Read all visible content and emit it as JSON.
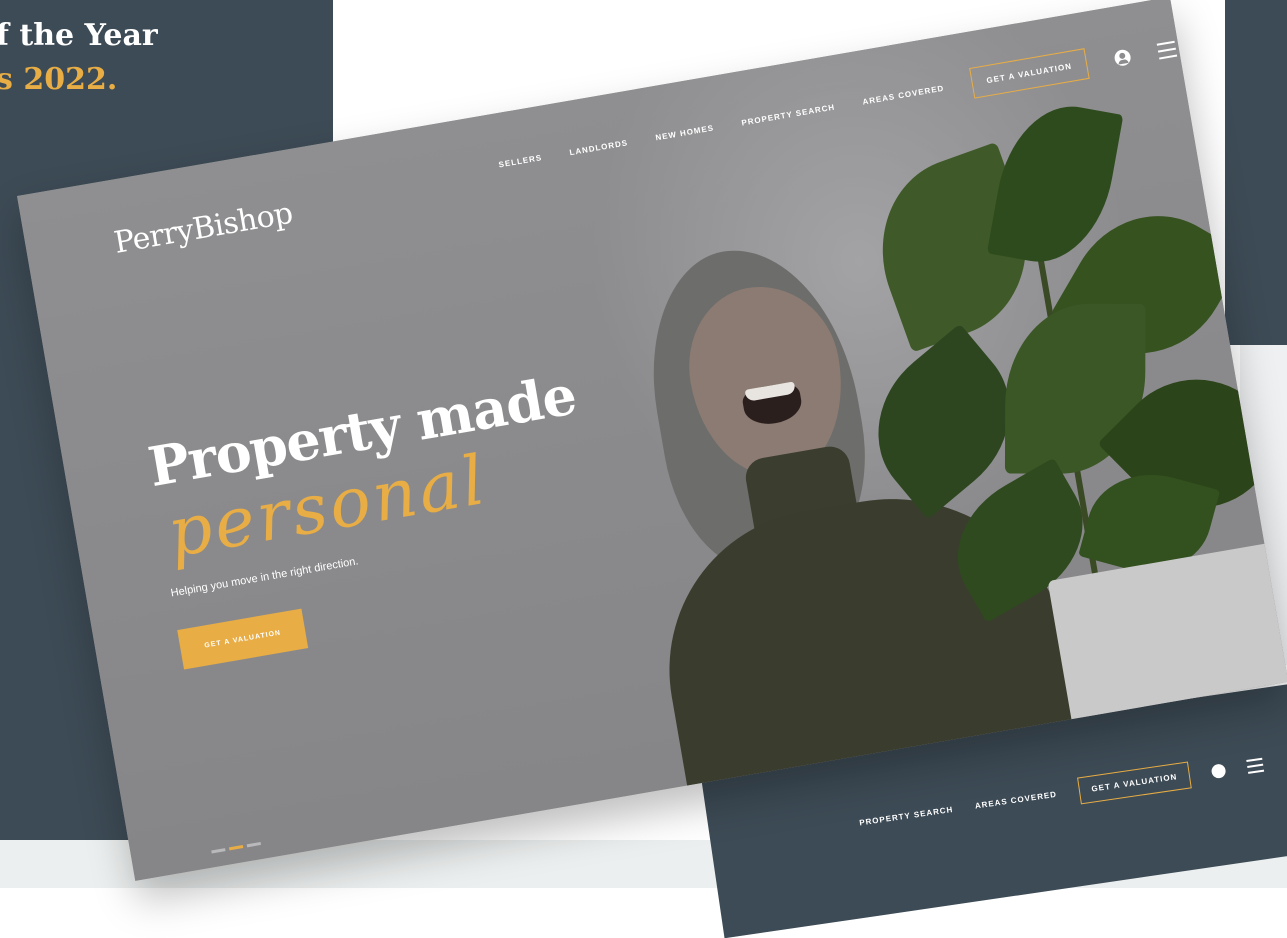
{
  "background": {
    "award_line_1": "f the Year",
    "award_line_2": "s 2022."
  },
  "hero": {
    "logo": "PerryBishop",
    "nav": [
      "SELLERS",
      "LANDLORDS",
      "NEW HOMES",
      "PROPERTY SEARCH",
      "AREAS COVERED"
    ],
    "nav_cta": "GET A VALUATION",
    "headline": "Property made",
    "script_word": "personal",
    "subtext": "Helping you move in the right direction.",
    "cta": "GET A VALUATION",
    "slides": {
      "count": 3,
      "active": 2
    }
  },
  "second_mockup": {
    "nav": [
      "PROPERTY SEARCH",
      "AREAS COVERED"
    ],
    "cta": "GET A VALUATION"
  },
  "colors": {
    "navy": "#3d4b56",
    "accent": "#e8ad45",
    "hero_overlay": "#8d8d8f"
  },
  "icons": [
    "user-icon",
    "menu-icon"
  ]
}
